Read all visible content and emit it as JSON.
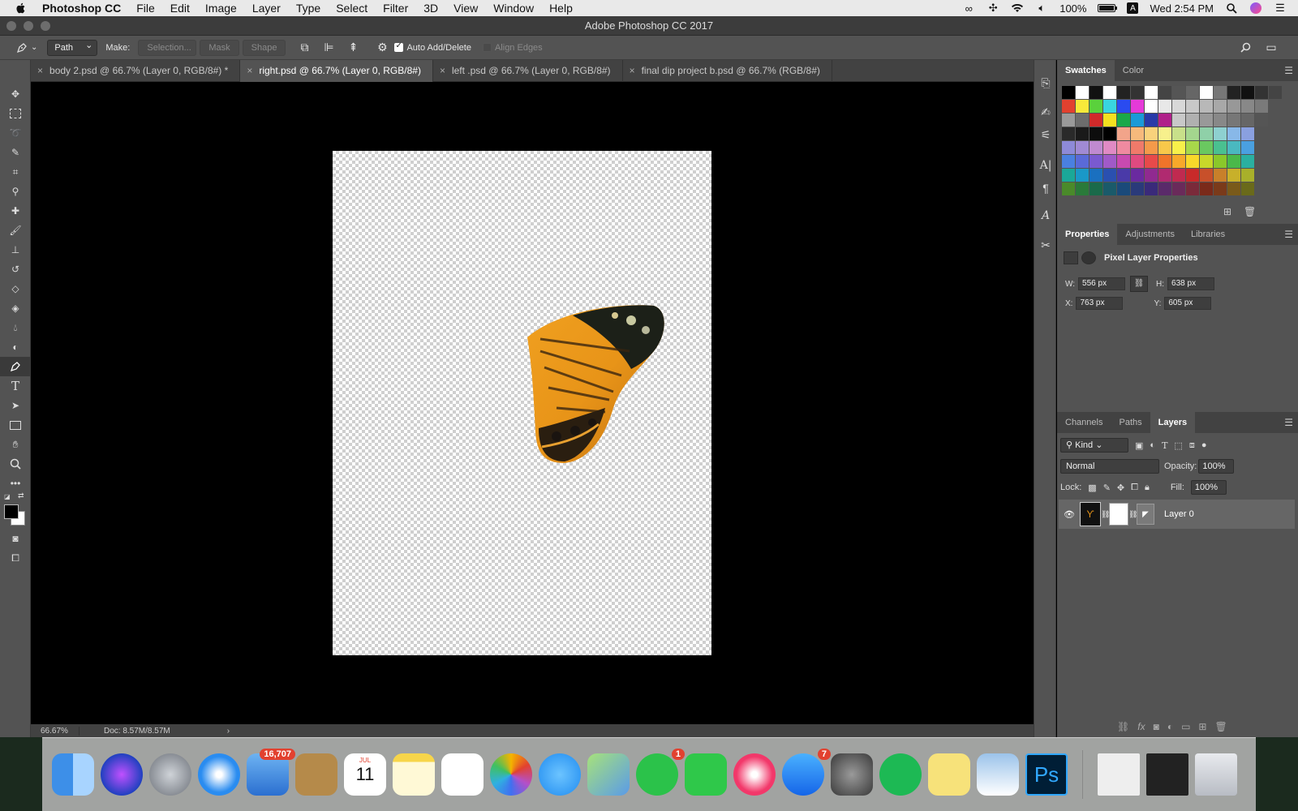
{
  "menubar": {
    "items": [
      "Photoshop CC",
      "File",
      "Edit",
      "Image",
      "Layer",
      "Type",
      "Select",
      "Filter",
      "3D",
      "View",
      "Window",
      "Help"
    ],
    "battery": "100%",
    "clock": "Wed 2:54 PM"
  },
  "window": {
    "title": "Adobe Photoshop CC 2017"
  },
  "options": {
    "mode": "Path",
    "make_label": "Make:",
    "selection_btn": "Selection...",
    "mask_btn": "Mask",
    "shape_btn": "Shape",
    "auto_add_delete": "Auto Add/Delete",
    "align_edges": "Align Edges"
  },
  "tabs": [
    {
      "label": "body 2.psd @ 66.7% (Layer 0, RGB/8#) *"
    },
    {
      "label": "right.psd @ 66.7% (Layer 0, RGB/8#)"
    },
    {
      "label": "left .psd @ 66.7% (Layer 0, RGB/8#)"
    },
    {
      "label": "final dip project b.psd @ 66.7% (RGB/8#)"
    }
  ],
  "status": {
    "zoom": "66.67%",
    "doc": "Doc: 8.57M/8.57M"
  },
  "swatches_panel": {
    "tabs": [
      "Swatches",
      "Color"
    ]
  },
  "properties_panel": {
    "tabs": [
      "Properties",
      "Adjustments",
      "Libraries"
    ],
    "heading": "Pixel Layer Properties",
    "w_label": "W:",
    "w": "556 px",
    "h_label": "H:",
    "h": "638 px",
    "x_label": "X:",
    "x": "763 px",
    "y_label": "Y:",
    "y": "605 px"
  },
  "layers_panel": {
    "tabs": [
      "Channels",
      "Paths",
      "Layers"
    ],
    "kind": "Kind",
    "blend_mode": "Normal",
    "opacity_label": "Opacity:",
    "opacity": "100%",
    "lock_label": "Lock:",
    "fill_label": "Fill:",
    "fill": "100%",
    "layer_name": "Layer 0"
  },
  "dock": {
    "mail_badge": "16,707",
    "calendar_month": "JUL",
    "calendar_day": "11",
    "whatsapp_badge": "1",
    "appstore_badge": "7",
    "ps_label": "Ps"
  },
  "colors": {
    "ui_bg": "#535353",
    "panel_dark": "#424242",
    "accent": "#31a8ff"
  }
}
